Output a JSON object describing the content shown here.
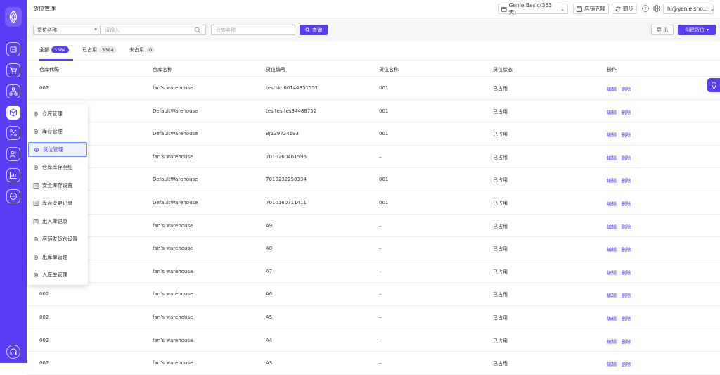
{
  "header": {
    "title": "货位管理",
    "plan_label": "Genie Basic(363 天)",
    "clone_label": "店铺克隆",
    "sync_label": "同步",
    "user_email": "hi@genie.sho..."
  },
  "filter": {
    "field_select": "货位名称",
    "search_placeholder": "请输入",
    "warehouse_placeholder": "仓库名称",
    "query_label": "查询",
    "export_label": "导 出",
    "create_label": "创建货位"
  },
  "tabs": [
    {
      "label": "全部",
      "count": "3384"
    },
    {
      "label": "已占用",
      "count": "3384"
    },
    {
      "label": "未占用",
      "count": "0"
    }
  ],
  "columns": [
    "仓库代码",
    "仓库名称",
    "货位编号",
    "货位名称",
    "货位状态",
    "操作"
  ],
  "rows": [
    {
      "wh_code": "002",
      "wh_name": "fan’s warehouse",
      "loc_code": "testsku00144851551",
      "loc_name": "001",
      "status": "已占用"
    },
    {
      "wh_code": "",
      "wh_name": "DefaultWarehouse",
      "loc_code": "tes tes tes34488752",
      "loc_name": "001",
      "status": "已占用"
    },
    {
      "wh_code": "",
      "wh_name": "DefaultWarehouse",
      "loc_code": "BJ139724193",
      "loc_name": "001",
      "status": "已占用"
    },
    {
      "wh_code": "",
      "wh_name": "fan’s warehouse",
      "loc_code": "7010260461596",
      "loc_name": "–",
      "status": "已占用"
    },
    {
      "wh_code": "",
      "wh_name": "DefaultWarehouse",
      "loc_code": "7010232258334",
      "loc_name": "001",
      "status": "已占用"
    },
    {
      "wh_code": "",
      "wh_name": "DefaultWarehouse",
      "loc_code": "7010160711411",
      "loc_name": "001",
      "status": "已占用"
    },
    {
      "wh_code": "",
      "wh_name": "fan’s warehouse",
      "loc_code": "A9",
      "loc_name": "–",
      "status": "已占用"
    },
    {
      "wh_code": "",
      "wh_name": "fan’s warehouse",
      "loc_code": "A8",
      "loc_name": "–",
      "status": "已占用"
    },
    {
      "wh_code": "",
      "wh_name": "fan’s warehouse",
      "loc_code": "A7",
      "loc_name": "–",
      "status": "已占用"
    },
    {
      "wh_code": "002",
      "wh_name": "fan’s warehouse",
      "loc_code": "A6",
      "loc_name": "–",
      "status": "已占用"
    },
    {
      "wh_code": "002",
      "wh_name": "fan’s warehouse",
      "loc_code": "A5",
      "loc_name": "–",
      "status": "已占用"
    },
    {
      "wh_code": "002",
      "wh_name": "fan’s warehouse",
      "loc_code": "A4",
      "loc_name": "–",
      "status": "已占用"
    },
    {
      "wh_code": "002",
      "wh_name": "fan’s warehouse",
      "loc_code": "A3",
      "loc_name": "–",
      "status": "已占用"
    }
  ],
  "row_actions": {
    "edit": "编辑",
    "delete": "删除"
  },
  "submenu": [
    {
      "label": "仓库管理",
      "icon": "gear-icon"
    },
    {
      "label": "库存管理",
      "icon": "gear-icon"
    },
    {
      "label": "货位管理",
      "icon": "gear-icon",
      "active": true
    },
    {
      "label": "仓库库存明细",
      "icon": "gear-icon"
    },
    {
      "label": "安全库存设置",
      "icon": "document-icon"
    },
    {
      "label": "库存变更记录",
      "icon": "document-icon"
    },
    {
      "label": "出入库记录",
      "icon": "document-icon"
    },
    {
      "label": "店铺发货仓设置",
      "icon": "gear-icon"
    },
    {
      "label": "出库单管理",
      "icon": "gear-icon"
    },
    {
      "label": "入库单管理",
      "icon": "gear-icon"
    }
  ],
  "sidebar": {
    "icons": [
      "store-icon",
      "cart-icon",
      "sitemap-icon",
      "box-icon",
      "percent-icon",
      "users-icon",
      "chart-icon",
      "message-icon",
      "headset-icon"
    ],
    "active_index": 3
  },
  "colors": {
    "brand": "#5b3cf5",
    "rail": "#5b3cf5"
  }
}
